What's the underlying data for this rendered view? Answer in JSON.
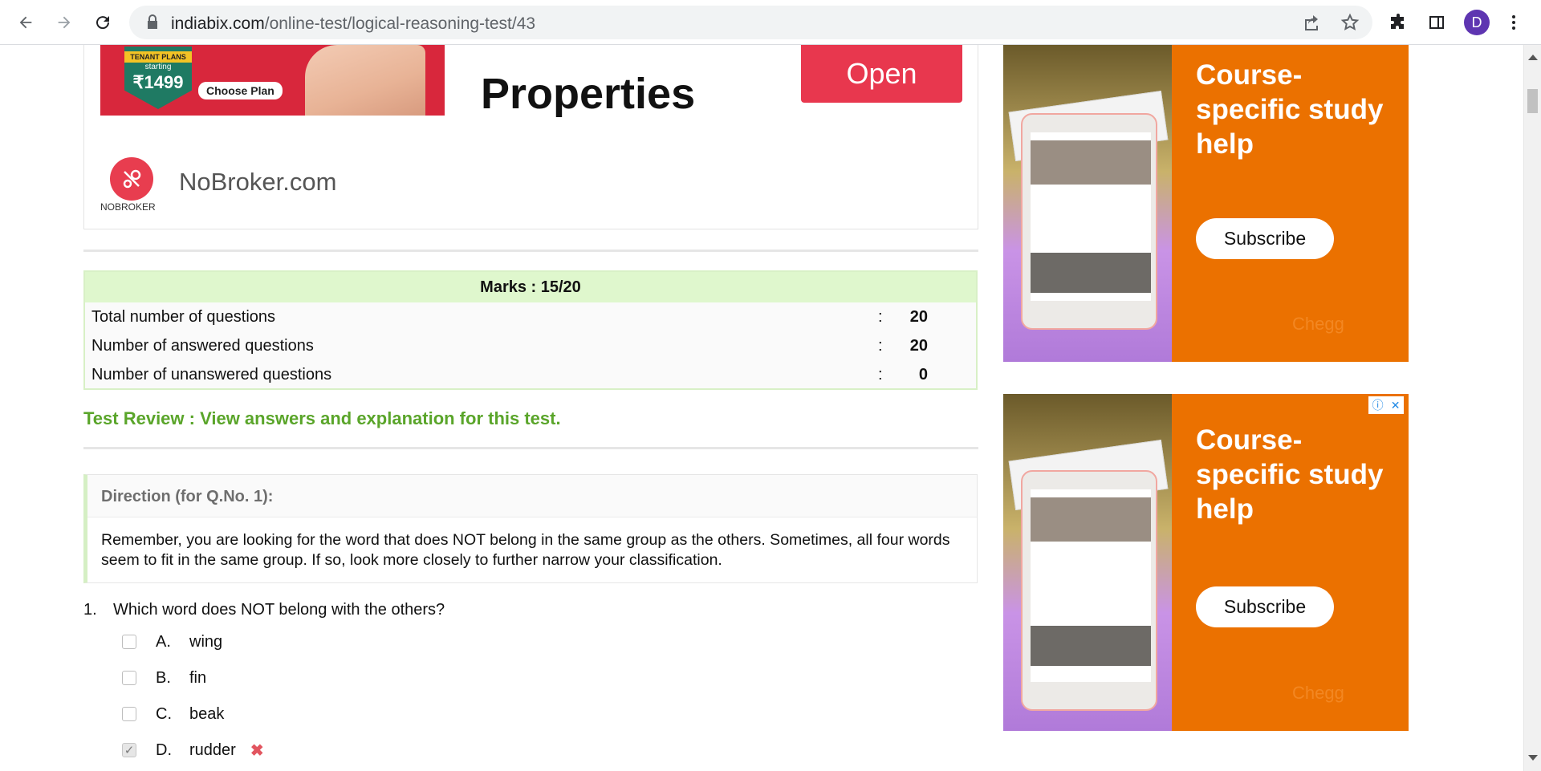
{
  "browser": {
    "url_host": "indiabix.com",
    "url_path": "/online-test/logical-reasoning-test/43",
    "profile_initial": "D"
  },
  "ad_top": {
    "tenant_plans": "TENANT PLANS",
    "starting": "starting",
    "price": "₹1499",
    "choose_plan": "Choose Plan",
    "headline": "Properties",
    "open_label": "Open",
    "brand_word": "NOBROKER",
    "brand_name": "NoBroker.com"
  },
  "marks": {
    "title": "Marks : 15/20",
    "rows": [
      {
        "label": "Total number of questions",
        "value": "20"
      },
      {
        "label": "Number of answered questions",
        "value": "20"
      },
      {
        "label": "Number of unanswered questions",
        "value": "0"
      }
    ]
  },
  "review_link": "Test Review : View answers and explanation for this test.",
  "direction": {
    "title": "Direction (for Q.No. 1):",
    "text": "Remember, you are looking for the word that does NOT belong in the same group as the others. Sometimes, all four words seem to fit in the same group. If so, look more closely to further narrow your classification."
  },
  "question": {
    "number": "1.",
    "text": "Which word does NOT belong with the others?",
    "options": [
      {
        "letter": "A.",
        "text": "wing",
        "checked": false
      },
      {
        "letter": "B.",
        "text": "fin",
        "checked": false
      },
      {
        "letter": "C.",
        "text": "beak",
        "checked": false
      },
      {
        "letter": "D.",
        "text": "rudder",
        "checked": true,
        "wrong": true
      }
    ]
  },
  "side_ads": [
    {
      "title": "Course-specific study help",
      "button": "Subscribe",
      "brand": "Chegg"
    },
    {
      "title": "Course-specific study help",
      "button": "Subscribe",
      "brand": "Chegg"
    }
  ],
  "icons": {
    "back": "arrow-left-icon",
    "forward": "arrow-right-icon",
    "reload": "reload-icon",
    "lock": "lock-icon",
    "share": "share-icon",
    "bookmark": "star-icon",
    "extensions": "puzzle-icon",
    "sidepanel": "side-panel-icon",
    "menu": "kebab-menu-icon",
    "wrong": "cross-icon"
  },
  "colors": {
    "marks_header_bg": "#dff7cd",
    "review_link": "#5aa52a",
    "chegg_orange": "#eb7100",
    "open_button": "#e8374e",
    "wrong_mark": "#e2555f"
  }
}
